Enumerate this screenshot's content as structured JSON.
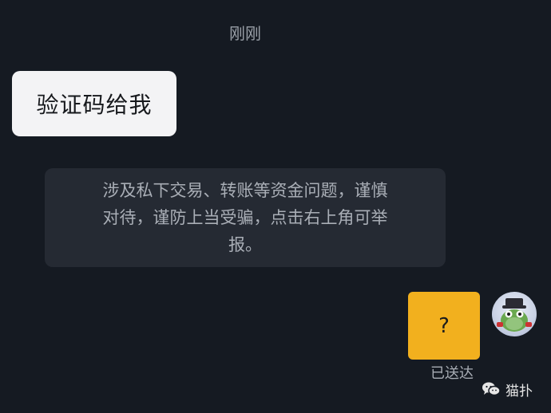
{
  "chat": {
    "timestamp": "刚刚",
    "incoming_message": "验证码给我",
    "warning_line1": "涉及私下交易、转账等资金问题，谨慎",
    "warning_line2": "对待，谨防上当受骗，点击右上角可举",
    "warning_line3": "报。",
    "outgoing_message": "?",
    "delivery_status": "已送达"
  },
  "watermark": {
    "icon": "wechat-icon",
    "label": "猫扑"
  },
  "colors": {
    "background": "#151a22",
    "incoming_bubble": "#f3f3f5",
    "warning_box": "#252a33",
    "outgoing_bubble": "#f2b01e"
  }
}
